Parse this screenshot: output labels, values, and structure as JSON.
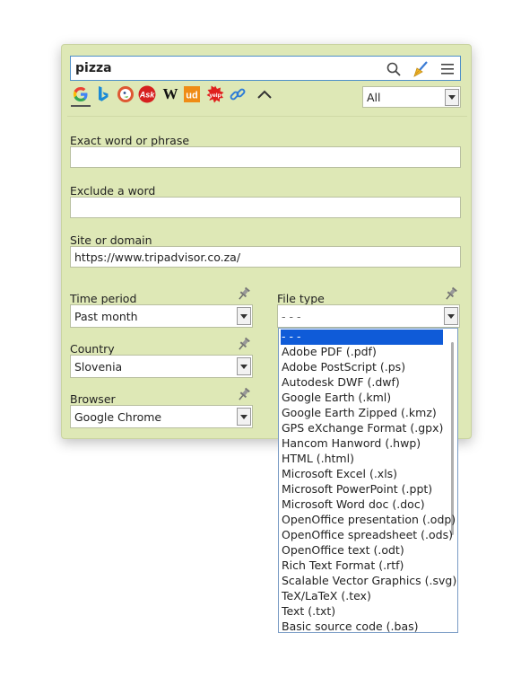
{
  "search": {
    "query": "pizza"
  },
  "engines": [
    "google-icon",
    "bing-icon",
    "duckduckgo-icon",
    "ask-icon",
    "wikipedia-icon",
    "urban-dictionary-icon",
    "yelp-icon",
    "link-icon"
  ],
  "engine_labels": {
    "ask": "Ask",
    "wikipedia": "W",
    "urban": "ud"
  },
  "scope": {
    "value": "All"
  },
  "exact": {
    "label": "Exact word or phrase",
    "value": ""
  },
  "exclude": {
    "label": "Exclude a word",
    "value": ""
  },
  "site": {
    "label": "Site or domain",
    "value": "https://www.tripadvisor.co.za/"
  },
  "time": {
    "label": "Time period",
    "value": "Past month"
  },
  "country": {
    "label": "Country",
    "value": "Slovenia"
  },
  "browser": {
    "label": "Browser",
    "value": "Google Chrome"
  },
  "filetype": {
    "label": "File type",
    "value": "- - -",
    "options": [
      "- - -",
      "Adobe PDF (.pdf)",
      "Adobe PostScript (.ps)",
      "Autodesk DWF (.dwf)",
      "Google Earth (.kml)",
      "Google Earth Zipped (.kmz)",
      "GPS eXchange Format (.gpx)",
      "Hancom Hanword (.hwp)",
      "HTML (.html)",
      "Microsoft Excel (.xls)",
      "Microsoft PowerPoint (.ppt)",
      "Microsoft Word doc (.doc)",
      "OpenOffice presentation (.odp)",
      "OpenOffice spreadsheet (.ods)",
      "OpenOffice text (.odt)",
      "Rich Text Format (.rtf)",
      "Scalable Vector Graphics (.svg)",
      "TeX/LaTeX (.tex)",
      "Text (.txt)",
      "Basic source code (.bas)"
    ]
  },
  "colors": {
    "panel": "#dee8b6",
    "selected": "#0f5bd8",
    "accent": "#4f90c8"
  }
}
